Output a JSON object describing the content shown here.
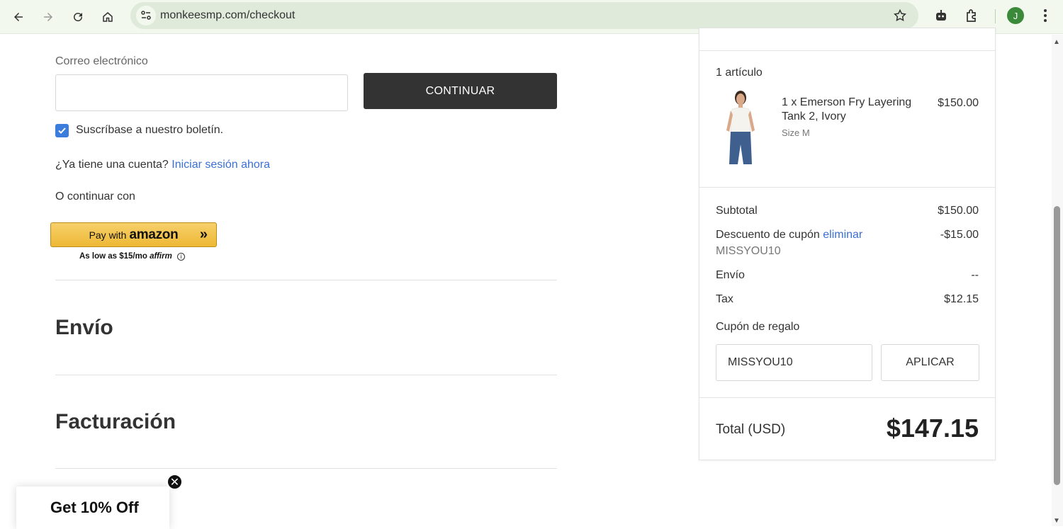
{
  "browser": {
    "url": "monkeesmp.com/checkout",
    "profile_initial": "J",
    "icons": [
      "back-icon",
      "forward-icon",
      "reload-icon",
      "home-icon",
      "site-info-icon",
      "bookmark-star-icon",
      "robot-icon",
      "extensions-icon",
      "menu-icon"
    ]
  },
  "contact": {
    "email_label": "Correo electrónico",
    "email_value": "",
    "continue_label": "CONTINUAR",
    "newsletter_label": "Suscríbase a nuestro boletín.",
    "newsletter_checked": true,
    "account_prompt": "¿Ya tiene una cuenta?",
    "login_link": "Iniciar sesión ahora",
    "or_continue": "O continuar con"
  },
  "amazon": {
    "pay_with": "Pay with",
    "brand": "amazon",
    "affirm_text": "As low as $15/mo",
    "affirm_brand": "affirm"
  },
  "sections": {
    "shipping": "Envío",
    "billing": "Facturación"
  },
  "summary": {
    "items_count": "1 artículo",
    "product": {
      "name": "1 x Emerson Fry Layering Tank 2, Ivory",
      "size": "Size M",
      "price": "$150.00"
    },
    "subtotal_label": "Subtotal",
    "subtotal_value": "$150.00",
    "discount_label": "Descuento de cupón",
    "discount_remove": "eliminar",
    "discount_value": "-$15.00",
    "discount_code": "MISSYOU10",
    "shipping_label": "Envío",
    "shipping_value": "--",
    "tax_label": "Tax",
    "tax_value": "$12.15",
    "gift_label": "Cupón de regalo",
    "gift_input_value": "MISSYOU10",
    "apply_label": "APLICAR",
    "total_label": "Total (USD)",
    "total_value": "$147.15"
  },
  "promo": {
    "text": "Get 10% Off",
    "close": "✕"
  }
}
